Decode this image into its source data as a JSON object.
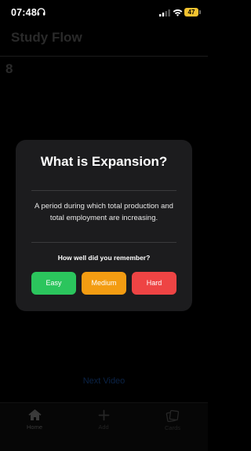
{
  "status_bar": {
    "time": "07:48",
    "battery_level": "47",
    "battery_color": "#f2c230"
  },
  "header": {
    "title": "Study Flow"
  },
  "card_count": "8",
  "next_video_label": "Next Video",
  "modal": {
    "question": "What is Expansion?",
    "answer": "A period during which total production and total employment are increasing.",
    "prompt": "How well did you remember?",
    "buttons": {
      "easy": "Easy",
      "medium": "Medium",
      "hard": "Hard"
    },
    "colors": {
      "easy": "#2bc55d",
      "medium": "#f39c12",
      "hard": "#ee4444",
      "card_background": "#1c1c1e"
    }
  },
  "tab_bar": {
    "items": [
      {
        "label": "Home",
        "icon": "home-icon",
        "selected": true
      },
      {
        "label": "Add",
        "icon": "plus-icon",
        "selected": false
      },
      {
        "label": "Cards",
        "icon": "cards-icon",
        "selected": false
      }
    ]
  }
}
